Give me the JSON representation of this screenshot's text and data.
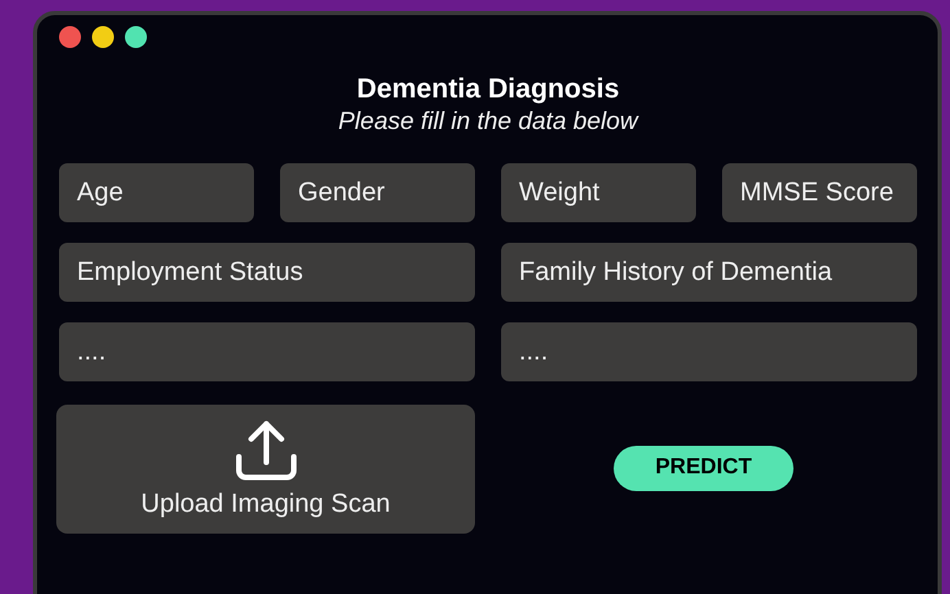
{
  "form": {
    "title": "Dementia Diagnosis",
    "subtitle": "Please fill in the data below"
  },
  "field_rows": [
    [
      {
        "placeholder": "Age"
      },
      {
        "placeholder": "Gender"
      },
      {
        "placeholder": "Weight"
      },
      {
        "placeholder": "MMSE Score"
      }
    ],
    [
      {
        "placeholder": "Employment Status"
      },
      {
        "placeholder": "Family History of Dementia"
      }
    ],
    [
      {
        "placeholder": "...."
      },
      {
        "placeholder": "...."
      }
    ]
  ],
  "upload": {
    "label": "Upload Imaging Scan"
  },
  "predict_button": {
    "label": "PREDICT"
  }
}
